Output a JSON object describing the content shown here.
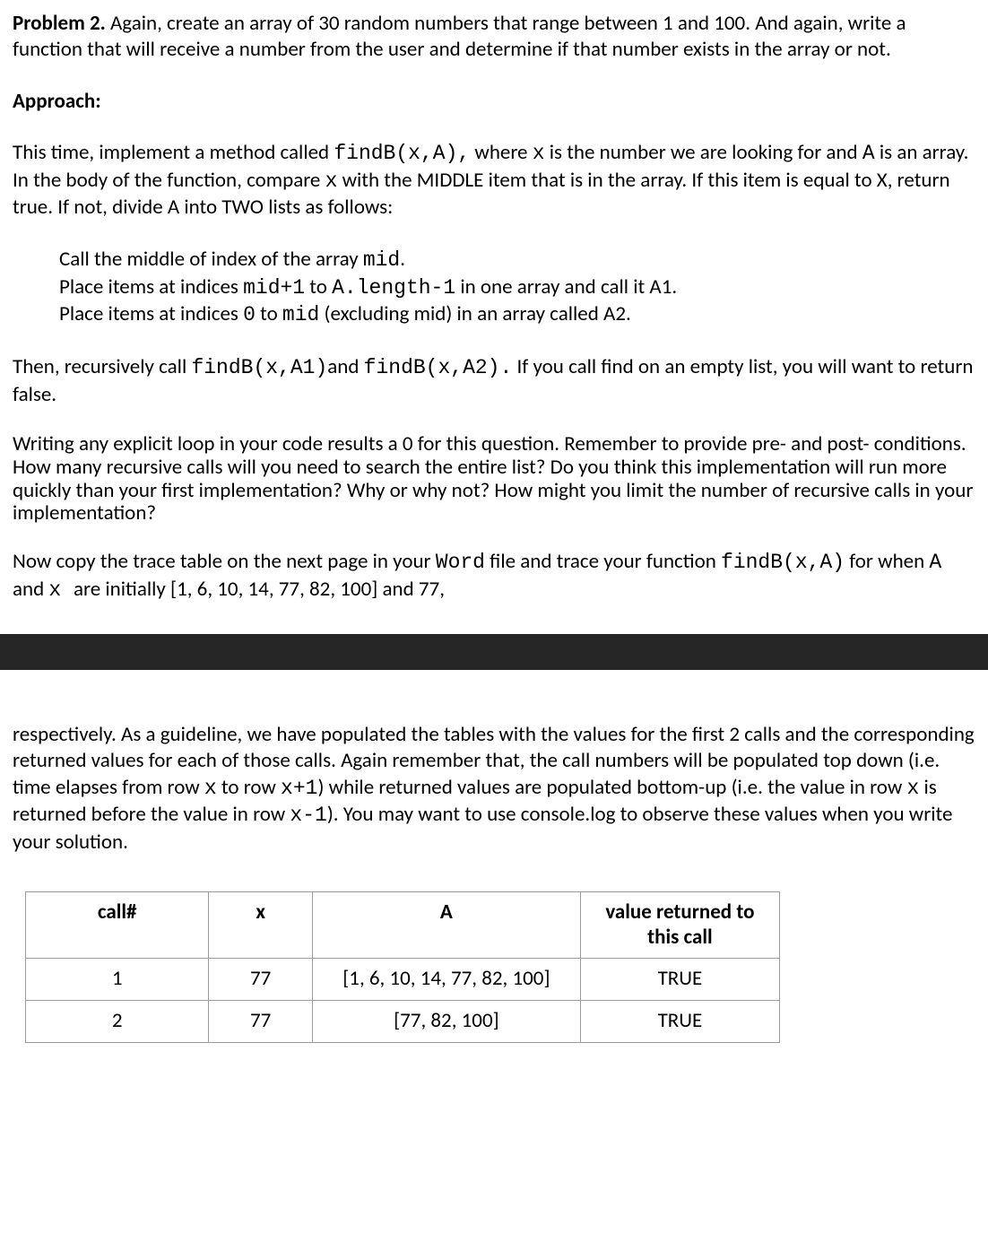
{
  "problem": {
    "label": "Problem 2.",
    "statement": " Again, create an array of 30 random numbers that range between 1 and 100. And again, write a function that will receive a number from the user and determine if that number exists in the array or not."
  },
  "approach": {
    "heading": "Approach:",
    "p1_pre": "This time, implement a method called ",
    "p1_code1": "findB(x,A),",
    "p1_mid1": "  where ",
    "p1_code2": "x",
    "p1_mid2": " is the number we are looking for and ",
    "p1_code3": "A",
    "p1_mid3": "  is an array.  In the body of the function, compare ",
    "p1_code4": "x",
    "p1_mid4": " with the MIDDLE item that is in the array. If this item is equal to X, return true.  If not, divide A into TWO lists as follows:"
  },
  "bullets": {
    "l1_pre": "Call the middle of index of the array ",
    "l1_code": "mid",
    "l1_post": ".",
    "l2_pre": "Place items at indices ",
    "l2_code1": "mid+1",
    "l2_mid": " to ",
    "l2_code2": "A.length-1",
    "l2_post": " in one array and call it A1.",
    "l3_pre": "Place items at indices ",
    "l3_code1": "0",
    "l3_mid": " to ",
    "l3_code2": "mid",
    "l3_post": " (excluding mid) in an array called A2."
  },
  "recurse": {
    "pre": "Then, recursively call ",
    "code1": "findB(x,A1)",
    "mid1": "and ",
    "code2": "findB(x,A2).",
    "post": "  If you call find on an empty list, you will want to return false."
  },
  "warning": "Writing any explicit loop in your code results a 0 for this question. Remember to provide pre- and post- conditions. How many recursive calls will you need to search the entire list?  Do you think this implementation will run more quickly than your first implementation?  Why or why not? How might you limit the number of recursive calls in your implementation?",
  "trace_instr": {
    "pre": "Now copy the trace table on the next page in your ",
    "code": "Word",
    "mid": "  file and trace your function ",
    "code2": "findB(x,A)",
    "mid2": " for when ",
    "code3": " A ",
    "mid3": " and ",
    "code4": " x ",
    "post": " are initially [1, 6, 10, 14, 77, 82, 100] and 77,"
  },
  "page2": {
    "p1_pre": "respectively. As a guideline, we have populated the tables with the values for the first 2 calls and the corresponding returned values for each of those calls. Again remember that, the call numbers will be populated top down (i.e. time elapses from row ",
    "p1_code1": "x",
    "p1_mid1": "  to row ",
    "p1_code2": "x+1",
    "p1_mid2": ") while returned values are populated bottom-up (i.e. the value in row ",
    "p1_code3": "x",
    "p1_mid3": "  is returned before the value in row ",
    "p1_code4": "x-1",
    "p1_post": "). You may want to use console.log to observe these values when you write your solution."
  },
  "chart_data": {
    "type": "table",
    "headers": [
      "call#",
      "x",
      "A",
      "value returned to this call"
    ],
    "rows": [
      [
        "1",
        "77",
        "[1, 6, 10, 14, 77, 82, 100]",
        "TRUE"
      ],
      [
        "2",
        "77",
        "[77, 82, 100]",
        "TRUE"
      ]
    ]
  }
}
